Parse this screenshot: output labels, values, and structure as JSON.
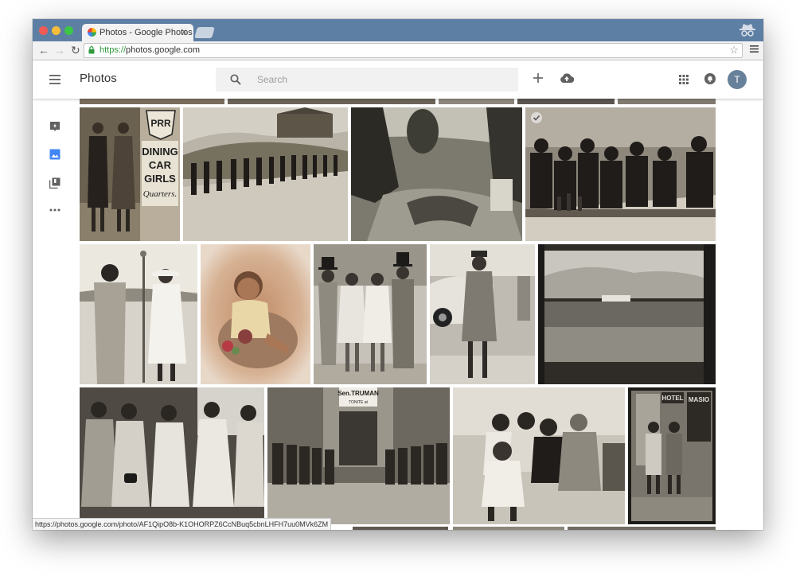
{
  "browser": {
    "tab_title": "Photos - Google Photos",
    "tab_close": "×",
    "url_scheme": "https://",
    "url_host": "photos.google.com",
    "back": "←",
    "forward": "→",
    "reload": "↻",
    "star": "☆",
    "status_url": "https://photos.google.com/photo/AF1QipO8b-K1OHORPZ6CcNBuq5cbnLHFH7uu0MVk6ZM"
  },
  "app": {
    "title": "Photos",
    "search_placeholder": "Search",
    "avatar_initial": "T"
  },
  "icons": {
    "menu": "hamburger-menu-icon",
    "search": "search-icon",
    "add": "plus-icon",
    "upload": "cloud-upload-icon",
    "apps": "apps-grid-icon",
    "notifications": "notifications-icon",
    "rail": [
      "assistant-icon",
      "photos-icon",
      "albums-icon",
      "more-icon"
    ]
  },
  "colors": {
    "chrome_tabstrip": "#5e7fa4",
    "accent_blue": "#4285f4",
    "avatar_bg": "#68819a",
    "secure_green": "#2e9a3b"
  },
  "photos": {
    "row1": [
      {
        "name": "dining-car-girls-photo",
        "sign_top": "PRR",
        "sign_lines": [
          "DINING",
          "CAR",
          "GIRLS",
          "Quarters."
        ]
      },
      {
        "name": "women-marching-photo"
      },
      {
        "name": "garden-landscape-photo"
      },
      {
        "name": "men-at-bar-photo",
        "selected": true
      }
    ],
    "row2": [
      {
        "name": "microphone-interview-photo"
      },
      {
        "name": "toddler-portrait-photo"
      },
      {
        "name": "top-hat-group-photo"
      },
      {
        "name": "policewoman-photo"
      },
      {
        "name": "stadium-photo"
      }
    ],
    "row3": [
      {
        "name": "women-in-dresses-photo"
      },
      {
        "name": "uniformed-women-line-photo",
        "sign_lines": [
          "Sen.TRUMAN",
          "TONITE at"
        ]
      },
      {
        "name": "couples-group-photo"
      },
      {
        "name": "hotel-doorway-photo",
        "sign_lines": [
          "HOTEL",
          "MASIO"
        ]
      }
    ]
  }
}
